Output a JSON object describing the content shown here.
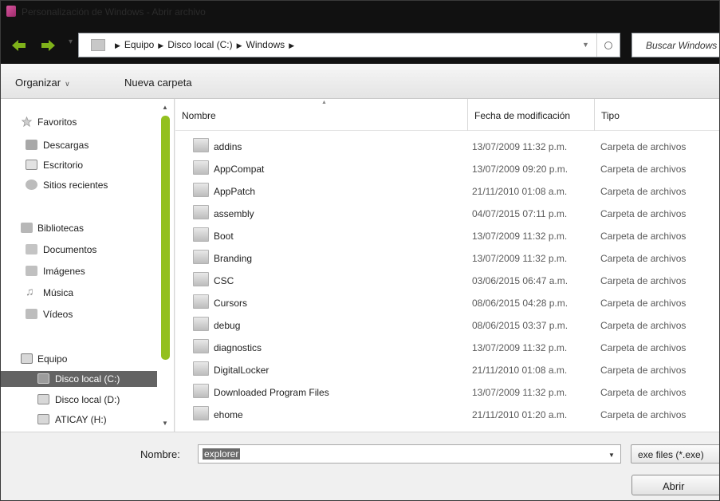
{
  "window": {
    "title": "Personalización de Windows - Abrir archivo",
    "accent_color": "#93c01f"
  },
  "address_bar": {
    "crumbs": [
      "Equipo",
      "Disco local (C:)",
      "Windows"
    ]
  },
  "search": {
    "placeholder": "Buscar Windows"
  },
  "toolbar": {
    "organize_label": "Organizar",
    "new_folder_label": "Nueva carpeta"
  },
  "nav_pane": {
    "items": [
      {
        "label": "Favoritos",
        "icon": "star-icon"
      },
      {
        "label": "Descargas",
        "icon": "downloads-folder-icon"
      },
      {
        "label": "Escritorio",
        "icon": "desktop-icon"
      },
      {
        "label": "Sitios recientes",
        "icon": "recent-places-icon"
      },
      {
        "label": "Bibliotecas",
        "icon": "libraries-icon"
      },
      {
        "label": "Documentos",
        "icon": "documents-icon"
      },
      {
        "label": "Imágenes",
        "icon": "pictures-icon"
      },
      {
        "label": "Música",
        "icon": "music-icon"
      },
      {
        "label": "Vídeos",
        "icon": "videos-icon"
      },
      {
        "label": "Equipo",
        "icon": "computer-icon"
      },
      {
        "label": "Disco local (C:)",
        "icon": "drive-icon",
        "selected": true
      },
      {
        "label": "Disco local (D:)",
        "icon": "drive-icon"
      },
      {
        "label": "ATICAY (H:)",
        "icon": "drive-icon"
      }
    ]
  },
  "file_list": {
    "columns": {
      "name": "Nombre",
      "date": "Fecha de modificación",
      "type": "Tipo"
    },
    "rows": [
      {
        "name": "addins",
        "date": "13/07/2009 11:32 p.m.",
        "type": "Carpeta de archivos"
      },
      {
        "name": "AppCompat",
        "date": "13/07/2009 09:20 p.m.",
        "type": "Carpeta de archivos"
      },
      {
        "name": "AppPatch",
        "date": "21/11/2010 01:08 a.m.",
        "type": "Carpeta de archivos"
      },
      {
        "name": "assembly",
        "date": "04/07/2015 07:11 p.m.",
        "type": "Carpeta de archivos"
      },
      {
        "name": "Boot",
        "date": "13/07/2009 11:32 p.m.",
        "type": "Carpeta de archivos"
      },
      {
        "name": "Branding",
        "date": "13/07/2009 11:32 p.m.",
        "type": "Carpeta de archivos"
      },
      {
        "name": "CSC",
        "date": "03/06/2015 06:47 a.m.",
        "type": "Carpeta de archivos"
      },
      {
        "name": "Cursors",
        "date": "08/06/2015 04:28 p.m.",
        "type": "Carpeta de archivos"
      },
      {
        "name": "debug",
        "date": "08/06/2015 03:37 p.m.",
        "type": "Carpeta de archivos"
      },
      {
        "name": "diagnostics",
        "date": "13/07/2009 11:32 p.m.",
        "type": "Carpeta de archivos"
      },
      {
        "name": "DigitalLocker",
        "date": "21/11/2010 01:08 a.m.",
        "type": "Carpeta de archivos"
      },
      {
        "name": "Downloaded Program Files",
        "date": "13/07/2009 11:32 p.m.",
        "type": "Carpeta de archivos"
      },
      {
        "name": "ehome",
        "date": "21/11/2010 01:20 a.m.",
        "type": "Carpeta de archivos"
      }
    ]
  },
  "bottom": {
    "filename_label": "Nombre:",
    "filename_value": "explorer",
    "file_type_filter": "exe files (*.exe)",
    "open_button": "Abrir"
  }
}
